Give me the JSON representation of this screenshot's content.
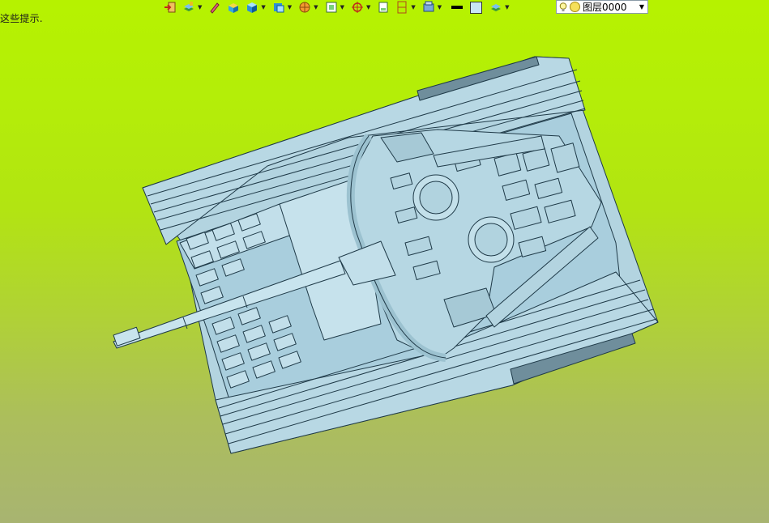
{
  "viewport": {
    "hint_text": "这些提示.",
    "background_top": "#b6f200",
    "background_bottom": "#a8b471"
  },
  "toolbar": {
    "items": [
      {
        "icon": "exit-door-icon",
        "has_dropdown": false
      },
      {
        "icon": "layer-stack-icon",
        "has_dropdown": true
      },
      {
        "icon": "pencil-icon",
        "has_dropdown": false
      },
      {
        "icon": "solid-box-icon",
        "has_dropdown": false
      },
      {
        "icon": "cube-view-icon",
        "has_dropdown": true
      },
      {
        "icon": "cube-face-icon",
        "has_dropdown": true
      },
      {
        "icon": "render-sphere-icon",
        "has_dropdown": true
      },
      {
        "icon": "frame-select-icon",
        "has_dropdown": true
      },
      {
        "icon": "crosshair-snap-icon",
        "has_dropdown": true
      },
      {
        "icon": "page-icon",
        "has_dropdown": false
      },
      {
        "icon": "split-view-icon",
        "has_dropdown": true
      },
      {
        "icon": "display-mode-icon",
        "has_dropdown": true
      }
    ],
    "line_color": "#000000",
    "fill_color": "#c8e6f4",
    "layer": {
      "name": "图层0000"
    }
  },
  "model": {
    "body_color": "#b3d4e0",
    "edge_color": "#1f3a48"
  }
}
